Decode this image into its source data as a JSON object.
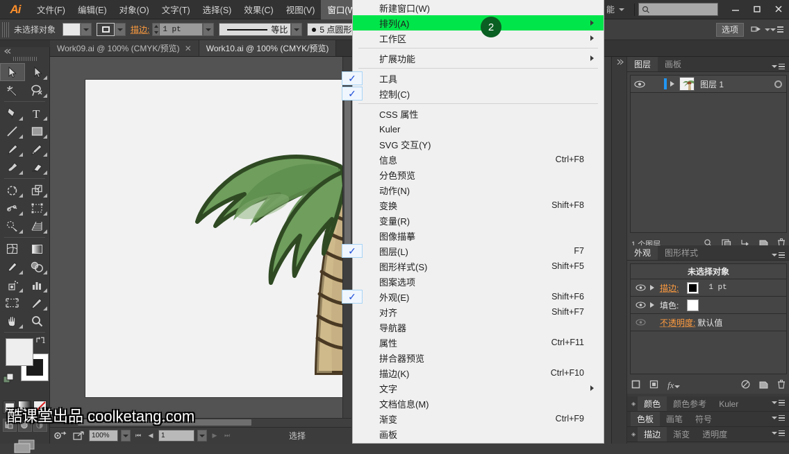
{
  "app": {
    "logo": "Ai"
  },
  "menubar": {
    "items": [
      {
        "label": "文件(F)",
        "active": false
      },
      {
        "label": "编辑(E)",
        "active": false
      },
      {
        "label": "对象(O)",
        "active": false
      },
      {
        "label": "文字(T)",
        "active": false
      },
      {
        "label": "选择(S)",
        "active": false
      },
      {
        "label": "效果(C)",
        "active": false
      },
      {
        "label": "视图(V)",
        "active": false
      },
      {
        "label": "窗口(W)",
        "active": true
      }
    ],
    "workspace_label": "能",
    "search_placeholder": "",
    "window_buttons": [
      "minimize",
      "maximize",
      "close"
    ]
  },
  "controlbar": {
    "selection_label": "未选择对象",
    "stroke_label": "描边:",
    "stroke_weight": "1 pt",
    "profile_label": "等比",
    "brush_label": "5 点圆形",
    "options_label": "选项"
  },
  "doctabs": [
    {
      "label": "Work09.ai @ 100% (CMYK/预览)",
      "active": false,
      "closable": true
    },
    {
      "label": "Work10.ai @ 100% (CMYK/预览)",
      "active": true,
      "closable": false
    }
  ],
  "menu": {
    "items": [
      {
        "label": "新建窗口(W)",
        "shortcut": "",
        "submenu": false,
        "checked": false,
        "highlight": false,
        "sep_after": false
      },
      {
        "label": "排列(A)",
        "shortcut": "",
        "submenu": true,
        "checked": false,
        "highlight": true,
        "badge": "2",
        "sep_after": false
      },
      {
        "label": "工作区",
        "shortcut": "",
        "submenu": true,
        "checked": false,
        "highlight": false,
        "sep_after": true
      },
      {
        "label": "扩展功能",
        "shortcut": "",
        "submenu": true,
        "checked": false,
        "highlight": false,
        "sep_after": true
      },
      {
        "label": "工具",
        "shortcut": "",
        "submenu": false,
        "checked": true,
        "highlight": false,
        "sep_after": false
      },
      {
        "label": "控制(C)",
        "shortcut": "",
        "submenu": false,
        "checked": true,
        "highlight": false,
        "sep_after": true
      },
      {
        "label": "CSS 属性",
        "shortcut": "",
        "submenu": false,
        "checked": false,
        "highlight": false,
        "sep_after": false
      },
      {
        "label": "Kuler",
        "shortcut": "",
        "submenu": false,
        "checked": false,
        "highlight": false,
        "sep_after": false
      },
      {
        "label": "SVG 交互(Y)",
        "shortcut": "",
        "submenu": false,
        "checked": false,
        "highlight": false,
        "sep_after": false
      },
      {
        "label": "信息",
        "shortcut": "Ctrl+F8",
        "submenu": false,
        "checked": false,
        "highlight": false,
        "sep_after": false
      },
      {
        "label": "分色预览",
        "shortcut": "",
        "submenu": false,
        "checked": false,
        "highlight": false,
        "sep_after": false
      },
      {
        "label": "动作(N)",
        "shortcut": "",
        "submenu": false,
        "checked": false,
        "highlight": false,
        "sep_after": false
      },
      {
        "label": "变换",
        "shortcut": "Shift+F8",
        "submenu": false,
        "checked": false,
        "highlight": false,
        "sep_after": false
      },
      {
        "label": "变量(R)",
        "shortcut": "",
        "submenu": false,
        "checked": false,
        "highlight": false,
        "sep_after": false
      },
      {
        "label": "图像描摹",
        "shortcut": "",
        "submenu": false,
        "checked": false,
        "highlight": false,
        "sep_after": false
      },
      {
        "label": "图层(L)",
        "shortcut": "F7",
        "submenu": false,
        "checked": true,
        "highlight": false,
        "sep_after": false
      },
      {
        "label": "图形样式(S)",
        "shortcut": "Shift+F5",
        "submenu": false,
        "checked": false,
        "highlight": false,
        "sep_after": false
      },
      {
        "label": "图案选项",
        "shortcut": "",
        "submenu": false,
        "checked": false,
        "highlight": false,
        "sep_after": false
      },
      {
        "label": "外观(E)",
        "shortcut": "Shift+F6",
        "submenu": false,
        "checked": true,
        "highlight": false,
        "sep_after": false
      },
      {
        "label": "对齐",
        "shortcut": "Shift+F7",
        "submenu": false,
        "checked": false,
        "highlight": false,
        "sep_after": false
      },
      {
        "label": "导航器",
        "shortcut": "",
        "submenu": false,
        "checked": false,
        "highlight": false,
        "sep_after": false
      },
      {
        "label": "属性",
        "shortcut": "Ctrl+F11",
        "submenu": false,
        "checked": false,
        "highlight": false,
        "sep_after": false
      },
      {
        "label": "拼合器预览",
        "shortcut": "",
        "submenu": false,
        "checked": false,
        "highlight": false,
        "sep_after": false
      },
      {
        "label": "描边(K)",
        "shortcut": "Ctrl+F10",
        "submenu": false,
        "checked": false,
        "highlight": false,
        "sep_after": false
      },
      {
        "label": "文字",
        "shortcut": "",
        "submenu": true,
        "checked": false,
        "highlight": false,
        "sep_after": false
      },
      {
        "label": "文档信息(M)",
        "shortcut": "",
        "submenu": false,
        "checked": false,
        "highlight": false,
        "sep_after": false
      },
      {
        "label": "渐变",
        "shortcut": "Ctrl+F9",
        "submenu": false,
        "checked": false,
        "highlight": false,
        "sep_after": false
      },
      {
        "label": "画板",
        "shortcut": "",
        "submenu": false,
        "checked": false,
        "highlight": false,
        "sep_after": false
      }
    ]
  },
  "layers_panel": {
    "tabs": [
      {
        "label": "图层",
        "active": true
      },
      {
        "label": "画板",
        "active": false
      }
    ],
    "rows": [
      {
        "name": "图层 1",
        "visible": true
      }
    ],
    "footer_count": "1 个图层"
  },
  "appearance_panel": {
    "tabs": [
      {
        "label": "外观",
        "active": true
      },
      {
        "label": "图形样式",
        "active": false
      }
    ],
    "title": "未选择对象",
    "rows": [
      {
        "label": "描边:",
        "value": "1 pt",
        "swatch": "#000000",
        "link": true
      },
      {
        "label": "填色:",
        "value": "",
        "swatch": "#ffffff",
        "link": false
      },
      {
        "label": "不透明度:",
        "value": "默认值",
        "swatch": "",
        "link": true
      }
    ]
  },
  "collapsed_panels": [
    {
      "tabs": [
        {
          "label": "颜色",
          "active": true
        },
        {
          "label": "颜色参考",
          "active": false
        },
        {
          "label": "Kuler",
          "active": false
        }
      ],
      "grip": true
    },
    {
      "tabs": [
        {
          "label": "色板",
          "active": true
        },
        {
          "label": "画笔",
          "active": false
        },
        {
          "label": "符号",
          "active": false
        }
      ],
      "grip": false
    },
    {
      "tabs": [
        {
          "label": "描边",
          "active": true
        },
        {
          "label": "渐变",
          "active": false
        },
        {
          "label": "透明度",
          "active": false
        }
      ],
      "grip": true
    }
  ],
  "statusbar": {
    "zoom": "100%",
    "page": "1",
    "tool_status": "选择"
  },
  "watermark": "酷课堂出品 coolketang.com",
  "colors": {
    "highlight_green": "#00e54a",
    "badge_green": "#0a5f22",
    "accent_orange": "#ff9c3f",
    "panel_bg": "#414141",
    "menu_bg": "#f0f0f0"
  }
}
